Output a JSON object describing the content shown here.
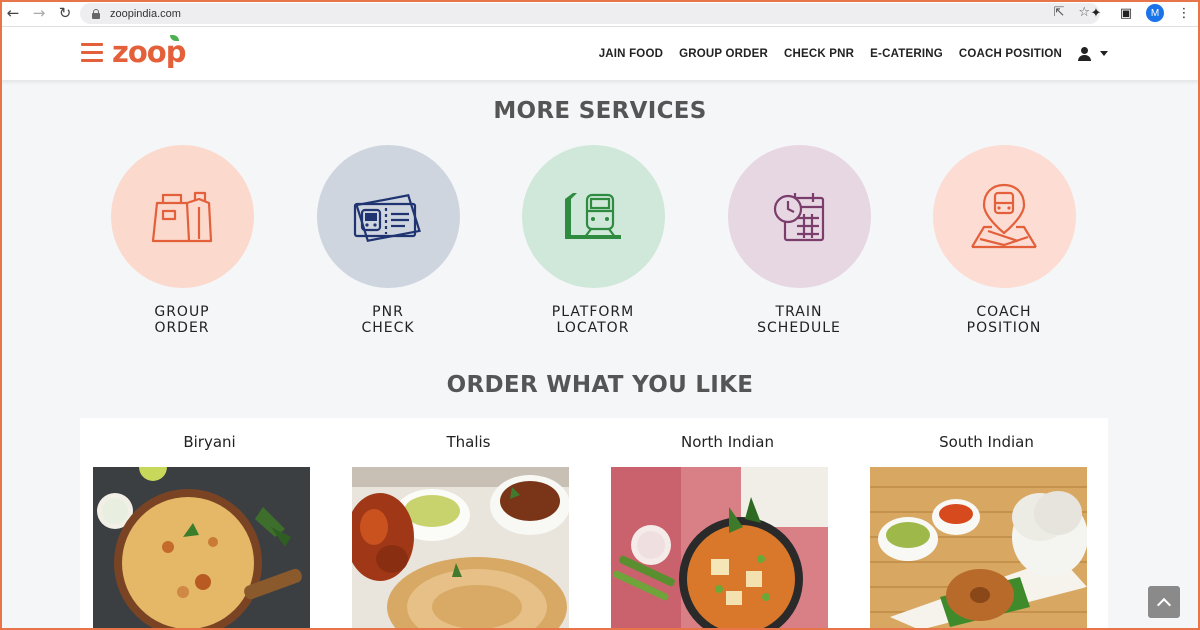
{
  "browser": {
    "url": "zoopindia.com",
    "profile_initial": "M"
  },
  "header": {
    "logo_text": "zoop",
    "menu": [
      "JAIN FOOD",
      "GROUP ORDER",
      "CHECK PNR",
      "E-CATERING",
      "COACH POSITION"
    ]
  },
  "services_section": {
    "title": "MORE SERVICES",
    "items": [
      {
        "line1": "GROUP",
        "line2": "ORDER",
        "icon": "bag-icon",
        "bg": "#fbd9cd"
      },
      {
        "line1": "PNR",
        "line2": "CHECK",
        "icon": "ticket-icon",
        "bg": "#cfd5df"
      },
      {
        "line1": "PLATFORM",
        "line2": "LOCATOR",
        "icon": "train-platform-icon",
        "bg": "#cfe8da"
      },
      {
        "line1": "TRAIN",
        "line2": "SCHEDULE",
        "icon": "calendar-clock-icon",
        "bg": "#e6d7e2"
      },
      {
        "line1": "COACH",
        "line2": "POSITION",
        "icon": "map-pin-bus-icon",
        "bg": "#fcdcd3"
      }
    ]
  },
  "food_section": {
    "title": "ORDER WHAT YOU LIKE",
    "items": [
      {
        "name": "Biryani"
      },
      {
        "name": "Thalis"
      },
      {
        "name": "North Indian"
      },
      {
        "name": "South Indian"
      }
    ]
  },
  "colors": {
    "brand": "#e3603a",
    "page_bg": "#f5f6f8"
  }
}
